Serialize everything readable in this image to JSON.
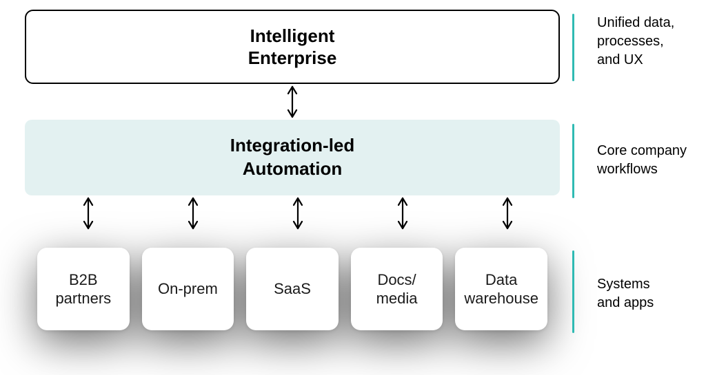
{
  "layers": {
    "top": {
      "title_line1": "Intelligent",
      "title_line2": "Enterprise"
    },
    "middle": {
      "title_line1": "Integration-led",
      "title_line2": "Automation"
    },
    "bottom": {
      "items": [
        {
          "label_line1": "B2B",
          "label_line2": "partners"
        },
        {
          "label_line1": "On-prem",
          "label_line2": ""
        },
        {
          "label_line1": "SaaS",
          "label_line2": ""
        },
        {
          "label_line1": "Docs/",
          "label_line2": "media"
        },
        {
          "label_line1": "Data",
          "label_line2": "warehouse"
        }
      ]
    }
  },
  "side_labels": {
    "top": {
      "line1": "Unified data,",
      "line2": "processes,",
      "line3": "and UX"
    },
    "middle": {
      "line1": "Core company",
      "line2": "workflows"
    },
    "bottom": {
      "line1": "Systems",
      "line2": "and apps"
    }
  },
  "colors": {
    "accent_bar": "#2fbab3",
    "mid_fill": "#e3f1f1"
  }
}
